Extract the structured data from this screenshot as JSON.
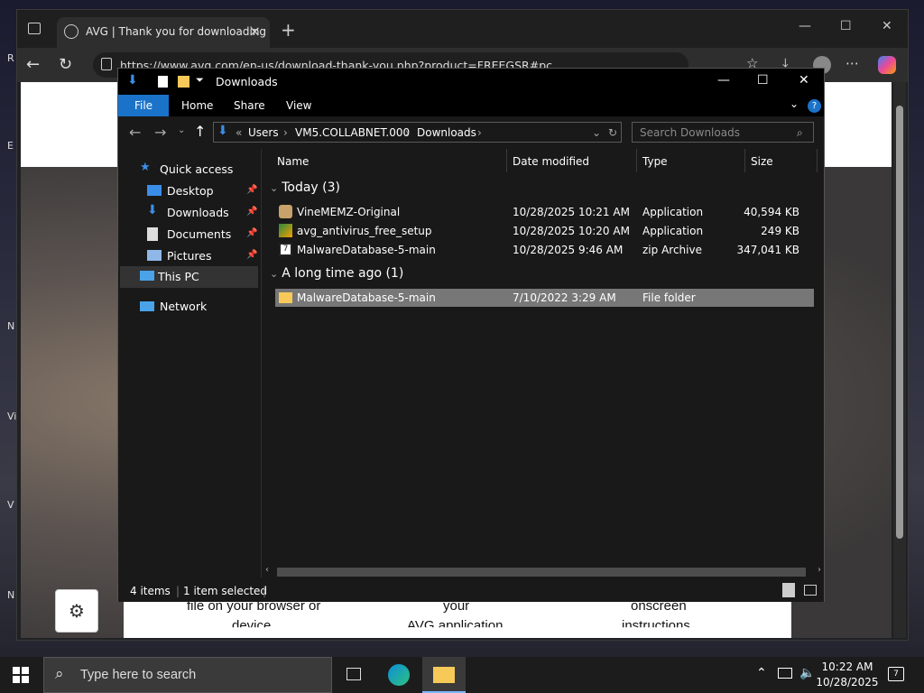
{
  "browser": {
    "tab_title": "AVG | Thank you for downloading",
    "url": "https://www.avg.com/en-us/download-thank-you.php?product=FREEGSR#pc",
    "bottom_text_1": "file on your browser or",
    "bottom_text_2": "your",
    "bottom_text_3": "onscreen",
    "bottom_text_4": "device",
    "bottom_text_5": "AVG application",
    "bottom_text_6": "instructions"
  },
  "explorer": {
    "title": "Downloads",
    "ribbon": {
      "file": "File",
      "home": "Home",
      "share": "Share",
      "view": "View"
    },
    "breadcrumb": [
      "Users",
      "VM5.COLLABNET.000",
      "Downloads"
    ],
    "search_placeholder": "Search Downloads",
    "nav": {
      "quick_access": "Quick access",
      "desktop": "Desktop",
      "downloads": "Downloads",
      "documents": "Documents",
      "pictures": "Pictures",
      "this_pc": "This PC",
      "network": "Network"
    },
    "columns": {
      "name": "Name",
      "date": "Date modified",
      "type": "Type",
      "size": "Size"
    },
    "groups": {
      "today": "Today (3)",
      "long_ago": "A long time ago (1)"
    },
    "files": [
      {
        "name": "VineMEMZ-Original",
        "date": "10/28/2025 10:21 AM",
        "type": "Application",
        "size": "40,594 KB"
      },
      {
        "name": "avg_antivirus_free_setup",
        "date": "10/28/2025 10:20 AM",
        "type": "Application",
        "size": "249 KB"
      },
      {
        "name": "MalwareDatabase-5-main",
        "date": "10/28/2025 9:46 AM",
        "type": "zip Archive",
        "size": "347,041 KB"
      },
      {
        "name": "MalwareDatabase-5-main",
        "date": "7/10/2022 3:29 AM",
        "type": "File folder",
        "size": ""
      }
    ],
    "status": {
      "items": "4 items",
      "selected": "1 item selected"
    }
  },
  "taskbar": {
    "search_placeholder": "Type here to search",
    "time": "10:22 AM",
    "date": "10/28/2025"
  },
  "colors": {
    "accent": "#1a73c9",
    "selection": "#777777"
  }
}
